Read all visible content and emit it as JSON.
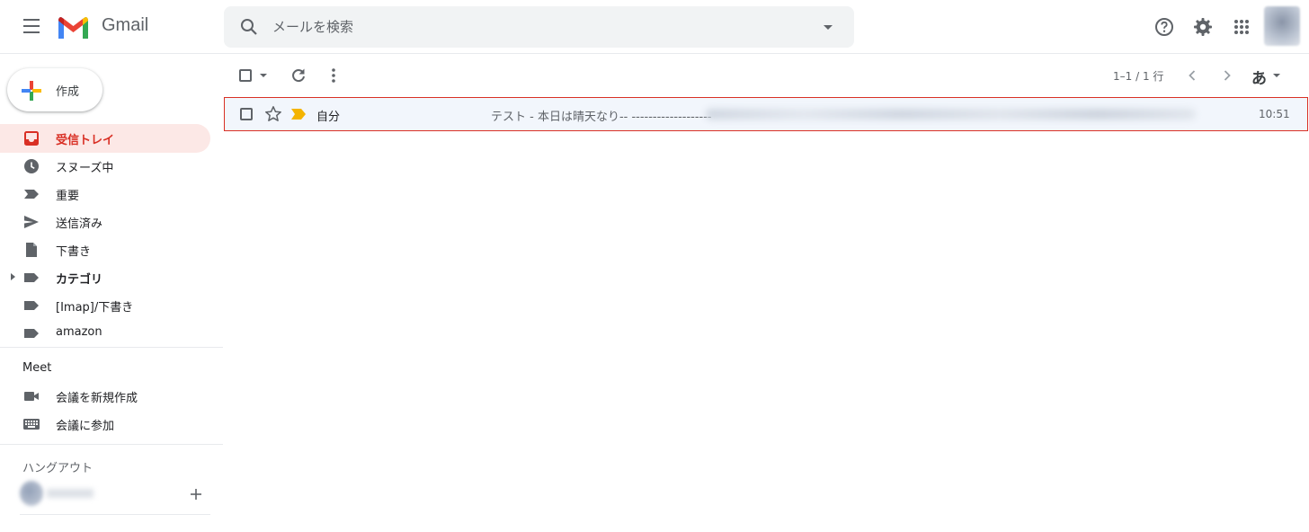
{
  "header": {
    "app_name": "Gmail",
    "search_placeholder": "メールを検索"
  },
  "sidebar": {
    "compose_label": "作成",
    "items": [
      {
        "label": "受信トレイ",
        "icon": "inbox-icon"
      },
      {
        "label": "スヌーズ中",
        "icon": "clock-icon"
      },
      {
        "label": "重要",
        "icon": "important-label-icon"
      },
      {
        "label": "送信済み",
        "icon": "send-icon"
      },
      {
        "label": "下書き",
        "icon": "draft-icon"
      },
      {
        "label": "カテゴリ",
        "icon": "label-icon"
      },
      {
        "label": "[Imap]/下書き",
        "icon": "label-icon"
      },
      {
        "label": "amazon",
        "icon": "label-icon"
      }
    ],
    "meet": {
      "title": "Meet",
      "items": [
        {
          "label": "会議を新規作成",
          "icon": "videocam-icon"
        },
        {
          "label": "会議に参加",
          "icon": "keyboard-icon"
        }
      ]
    },
    "hangouts": {
      "title": "ハングアウト"
    }
  },
  "toolbar": {
    "pagination": "1–1 / 1 行",
    "input_mode": "あ"
  },
  "emails": [
    {
      "sender": "自分",
      "subject": "テスト - 本日は晴天なり-- -------------------",
      "time": "10:51"
    }
  ],
  "colors": {
    "accent": "#d93025",
    "active_bg": "#fce8e6",
    "row_bg": "#f2f6fc",
    "important_marker": "#f4b400"
  }
}
